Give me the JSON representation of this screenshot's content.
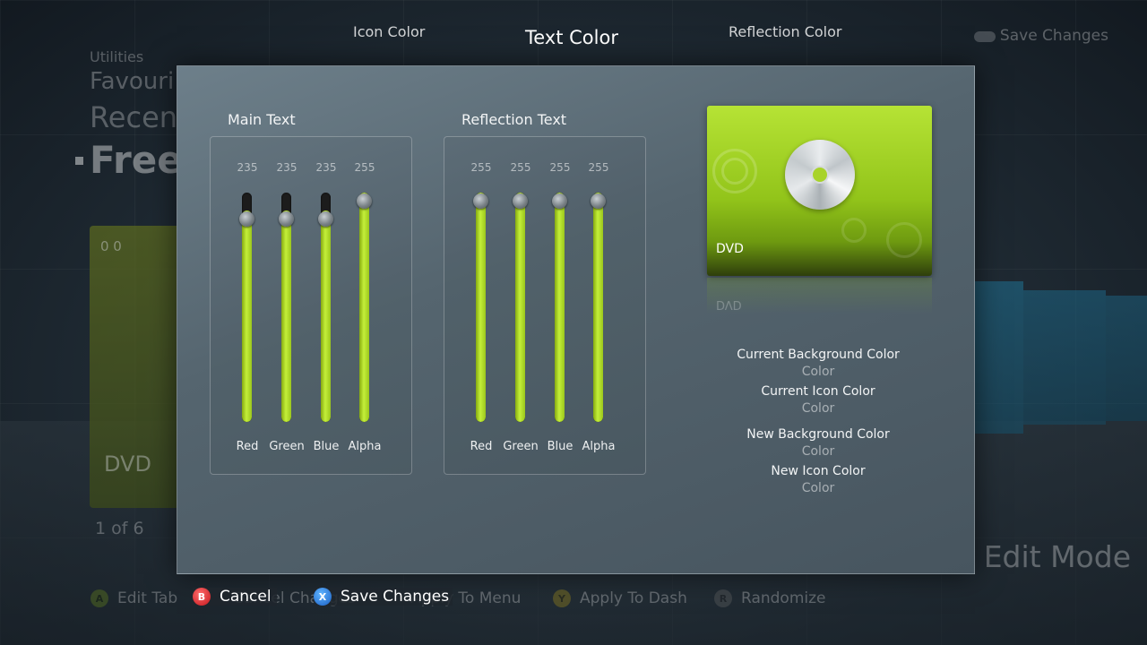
{
  "tabs": {
    "icon_color": "Icon Color",
    "text_color": "Text Color",
    "reflection_color": "Reflection Color"
  },
  "background": {
    "utilities": "Utilities",
    "favourites": "Favouri",
    "recent": "Recen",
    "free": "Free",
    "tile_top": "0 0",
    "tile_dvd": "DVD",
    "count": "1 of 6",
    "save_changes": "Save Changes",
    "edit_mode": "Edit Mode"
  },
  "main_text": {
    "title": "Main Text",
    "sliders": [
      {
        "label": "Red",
        "value": "235",
        "level": 0.92
      },
      {
        "label": "Green",
        "value": "235",
        "level": 0.92
      },
      {
        "label": "Blue",
        "value": "235",
        "level": 0.92
      },
      {
        "label": "Alpha",
        "value": "255",
        "level": 1.0
      }
    ]
  },
  "reflection_text": {
    "title": "Reflection Text",
    "sliders": [
      {
        "label": "Red",
        "value": "255",
        "level": 1.0
      },
      {
        "label": "Green",
        "value": "255",
        "level": 1.0
      },
      {
        "label": "Blue",
        "value": "255",
        "level": 1.0
      },
      {
        "label": "Alpha",
        "value": "255",
        "level": 1.0
      }
    ]
  },
  "preview": {
    "title": "DVD",
    "reflection": "DVD",
    "icon": "disc-icon",
    "accent": "#a8d32a"
  },
  "info": {
    "current_bg_label": "Current Background Color",
    "current_bg_value": "Color",
    "current_icon_label": "Current Icon Color",
    "current_icon_value": "Color",
    "new_bg_label": "New Background Color",
    "new_bg_value": "Color",
    "new_icon_label": "New Icon Color",
    "new_icon_value": "Color"
  },
  "bottom_bar": {
    "edit_tab": "Edit Tab",
    "cancel": "Cancel",
    "cancel_changes": "Cancel Changes",
    "save_changes": "Save Changes",
    "apply_menu": "Apply To Menu",
    "apply_dash": "Apply To Dash",
    "randomize": "Randomize",
    "btn_a": "A",
    "btn_b": "B",
    "btn_x": "X",
    "btn_y": "Y",
    "btn_r": "R"
  }
}
